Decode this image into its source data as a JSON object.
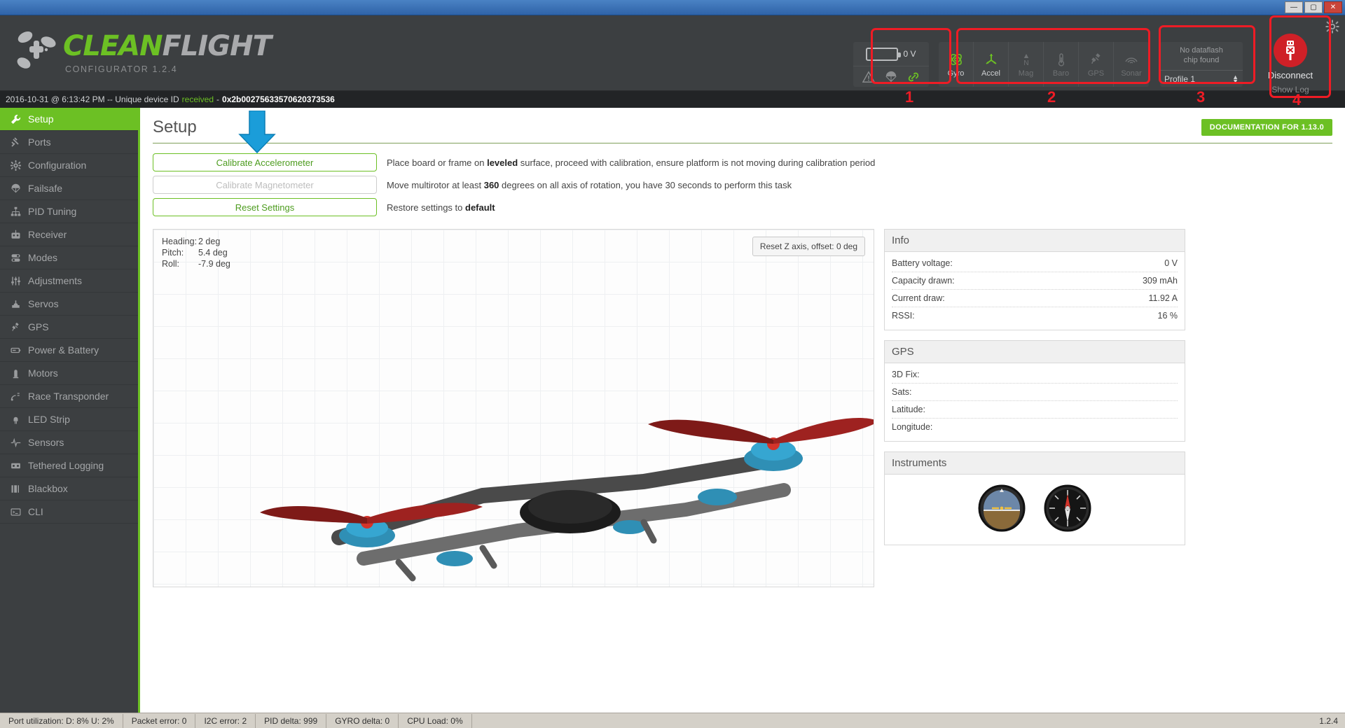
{
  "window": {
    "minimize": "—",
    "maximize": "▢",
    "close": "✕"
  },
  "header": {
    "logo_clean": "CLEAN",
    "logo_flight": "FLIGHT",
    "subtitle": "CONFIGURATOR  1.2.4",
    "battery": {
      "voltage": "0 V",
      "icons": [
        "warning-icon",
        "parachute-icon",
        "link-icon"
      ]
    },
    "sensors": [
      {
        "name": "Gyro",
        "icon": "gyro-icon",
        "active": true
      },
      {
        "name": "Accel",
        "icon": "accel-icon",
        "active": true
      },
      {
        "name": "Mag",
        "icon": "mag-icon",
        "active": false
      },
      {
        "name": "Baro",
        "icon": "baro-icon",
        "active": false
      },
      {
        "name": "GPS",
        "icon": "gps-icon",
        "active": false
      },
      {
        "name": "Sonar",
        "icon": "sonar-icon",
        "active": false
      }
    ],
    "dataflash": {
      "line1": "No dataflash",
      "line2": "chip found",
      "profile": "Profile 1"
    },
    "connection": {
      "label": "Disconnect",
      "show_log": "Show Log"
    }
  },
  "infoline": {
    "timestamp": "2016-10-31 @ 6:13:42 PM -- Unique device ID",
    "status": "received",
    "dash": "-",
    "device_id": "0x2b00275633570620373536"
  },
  "sidebar": {
    "items": [
      {
        "label": "Setup",
        "icon": "wrench-icon",
        "active": true
      },
      {
        "label": "Ports",
        "icon": "plug-icon",
        "active": false
      },
      {
        "label": "Configuration",
        "icon": "gear-icon",
        "active": false
      },
      {
        "label": "Failsafe",
        "icon": "parachute-icon",
        "active": false
      },
      {
        "label": "PID Tuning",
        "icon": "sitemap-icon",
        "active": false
      },
      {
        "label": "Receiver",
        "icon": "transmitter-icon",
        "active": false
      },
      {
        "label": "Modes",
        "icon": "toggles-icon",
        "active": false
      },
      {
        "label": "Adjustments",
        "icon": "sliders-icon",
        "active": false
      },
      {
        "label": "Servos",
        "icon": "servo-icon",
        "active": false
      },
      {
        "label": "GPS",
        "icon": "satellite-icon",
        "active": false
      },
      {
        "label": "Power & Battery",
        "icon": "battery-icon",
        "active": false
      },
      {
        "label": "Motors",
        "icon": "motor-icon",
        "active": false
      },
      {
        "label": "Race Transponder",
        "icon": "transponder-icon",
        "active": false
      },
      {
        "label": "LED Strip",
        "icon": "led-icon",
        "active": false
      },
      {
        "label": "Sensors",
        "icon": "pulse-icon",
        "active": false
      },
      {
        "label": "Tethered Logging",
        "icon": "logging-icon",
        "active": false
      },
      {
        "label": "Blackbox",
        "icon": "blackbox-icon",
        "active": false
      },
      {
        "label": "CLI",
        "icon": "terminal-icon",
        "active": false
      }
    ]
  },
  "main": {
    "title": "Setup",
    "doc_badge": "DOCUMENTATION FOR 1.13.0",
    "calibration": [
      {
        "button": "Calibrate Accelerometer",
        "disabled": false,
        "desc_pre": "Place board or frame on ",
        "desc_bold": "leveled",
        "desc_post": " surface, proceed with calibration, ensure platform is not moving during calibration period"
      },
      {
        "button": "Calibrate Magnetometer",
        "disabled": true,
        "desc_pre": "Move multirotor at least ",
        "desc_bold": "360",
        "desc_post": " degrees on all axis of rotation, you have 30 seconds to perform this task"
      },
      {
        "button": "Reset Settings",
        "disabled": false,
        "desc_pre": "Restore settings to ",
        "desc_bold": "default",
        "desc_post": ""
      }
    ],
    "attitude": {
      "heading_label": "Heading:",
      "heading_value": "2 deg",
      "pitch_label": "Pitch:",
      "pitch_value": "5.4 deg",
      "roll_label": "Roll:",
      "roll_value": "-7.9 deg"
    },
    "reset_z_button": "Reset Z axis, offset: 0 deg",
    "panels": {
      "info": {
        "title": "Info",
        "rows": [
          {
            "label": "Battery voltage:",
            "value": "0 V"
          },
          {
            "label": "Capacity drawn:",
            "value": "309 mAh"
          },
          {
            "label": "Current draw:",
            "value": "11.92 A"
          },
          {
            "label": "RSSI:",
            "value": "16 %"
          }
        ]
      },
      "gps": {
        "title": "GPS",
        "rows": [
          {
            "label": "3D Fix:",
            "value": ""
          },
          {
            "label": "Sats:",
            "value": ""
          },
          {
            "label": "Latitude:",
            "value": ""
          },
          {
            "label": "Longitude:",
            "value": ""
          }
        ]
      },
      "instruments": {
        "title": "Instruments",
        "gauges": [
          "attitude-indicator",
          "heading-indicator"
        ]
      }
    }
  },
  "statusbar": {
    "cells": [
      "Port utilization: D: 8% U: 2%",
      "Packet error: 0",
      "I2C error: 2",
      "PID delta: 999",
      "GYRO delta: 0",
      "CPU Load: 0%"
    ],
    "version": "1.2.4"
  },
  "annotations": {
    "numbers": [
      "1",
      "2",
      "3",
      "4"
    ],
    "accent_red": "#ee1c25",
    "accent_blue": "#1b9dd9",
    "accent_green": "#6cc024"
  }
}
